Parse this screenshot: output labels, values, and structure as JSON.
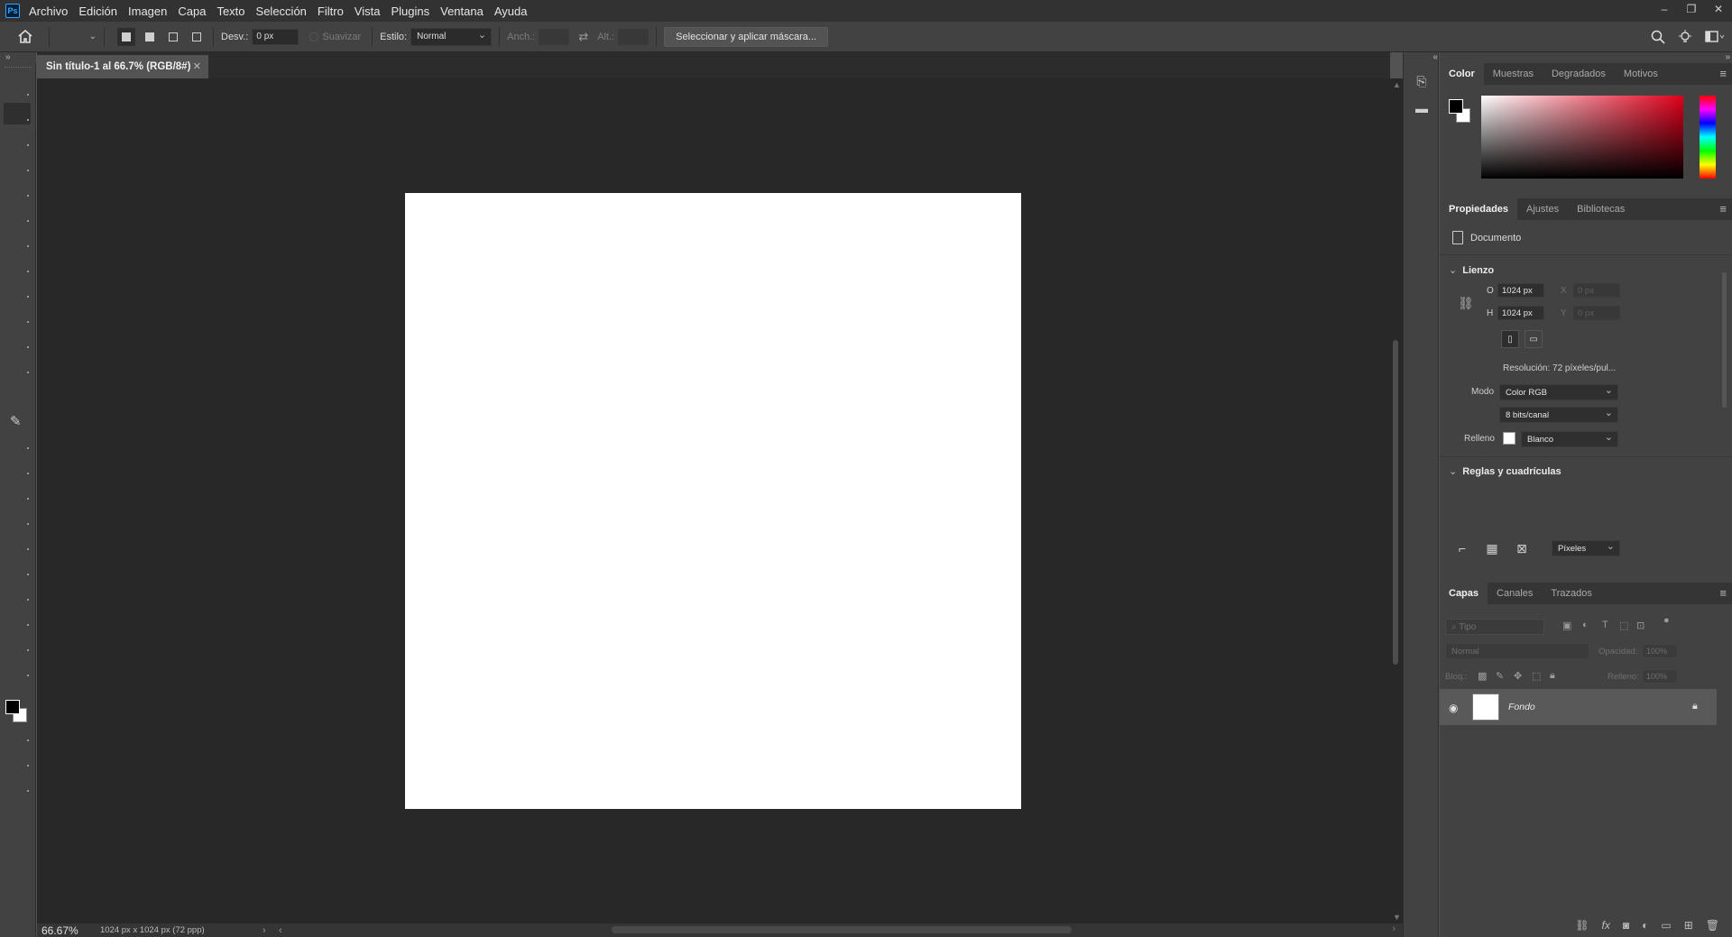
{
  "app": {
    "logo_text": "Ps"
  },
  "menu": [
    "Archivo",
    "Edición",
    "Imagen",
    "Capa",
    "Texto",
    "Selección",
    "Filtro",
    "Vista",
    "Plugins",
    "Ventana",
    "Ayuda"
  ],
  "window_controls": {
    "minimize": "–",
    "restore": "❐",
    "close": "✕"
  },
  "options_bar": {
    "feather_label": "Desv.:",
    "feather_value": "0 px",
    "antialias_label": "Suavizar",
    "style_label": "Estilo:",
    "style_value": "Normal",
    "width_label": "Anch.:",
    "height_label": "Alt.:",
    "select_mask_button": "Seleccionar y aplicar máscara..."
  },
  "document": {
    "tab_title": "Sin título-1 al 66.7% (RGB/8#)",
    "zoom": "66.67%",
    "info": "1024 px x 1024 px (72 ppp)"
  },
  "color_panel": {
    "tabs": [
      "Color",
      "Muestras",
      "Degradados",
      "Motivos"
    ],
    "active_tab": "Color",
    "hue_color": "#e0001b"
  },
  "properties_panel": {
    "tabs": [
      "Propiedades",
      "Ajustes",
      "Bibliotecas"
    ],
    "doc_label": "Documento",
    "canvas_section": "Lienzo",
    "width_label": "O",
    "width_value": "1024 px",
    "height_label": "H",
    "height_value": "1024 px",
    "x_label": "X",
    "x_placeholder": "0 px",
    "y_label": "Y",
    "y_placeholder": "0 px",
    "resolution": "Resolución:  72  píxeles/pul...",
    "mode_label": "Modo",
    "mode_value": "Color RGB",
    "depth_value": "8 bits/canal",
    "fill_label": "Relleno",
    "fill_value": "Blanco",
    "rulers_section": "Reglas y cuadrículas",
    "units_value": "Píxeles"
  },
  "layers_panel": {
    "tabs": [
      "Capas",
      "Canales",
      "Trazados"
    ],
    "filter_placeholder": "Tipo",
    "blend_mode": "Normal",
    "opacity_label": "Opacidad:",
    "opacity_value": "100%",
    "lock_label": "Bloq.:",
    "fill_label": "Relleno:",
    "fill_value": "100%",
    "layers": [
      {
        "name": "Fondo",
        "locked": true,
        "visible": true
      }
    ]
  }
}
